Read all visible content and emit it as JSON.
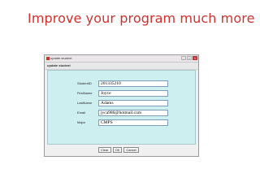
{
  "slide": {
    "title": "Improve your program much more"
  },
  "window": {
    "title": "update student",
    "minimize_icon": "minimize-icon",
    "maximize_icon": "maximize-icon",
    "close_icon": "close-icon",
    "menu_label": "update student"
  },
  "form": {
    "fields": [
      {
        "label": "StudentID",
        "value": "201335210"
      },
      {
        "label": "FirstName",
        "value": "Joyce"
      },
      {
        "label": "LastName",
        "value": "Adams"
      },
      {
        "label": "Email",
        "value": "jyca986@hotmail.com"
      },
      {
        "label": "Major",
        "value": "CMPS"
      }
    ]
  },
  "buttons": {
    "clear": "Clear",
    "ok": "OK",
    "cancel": "Cancel"
  },
  "colors": {
    "title": "#d0312d",
    "panel": "#cdeff0"
  }
}
